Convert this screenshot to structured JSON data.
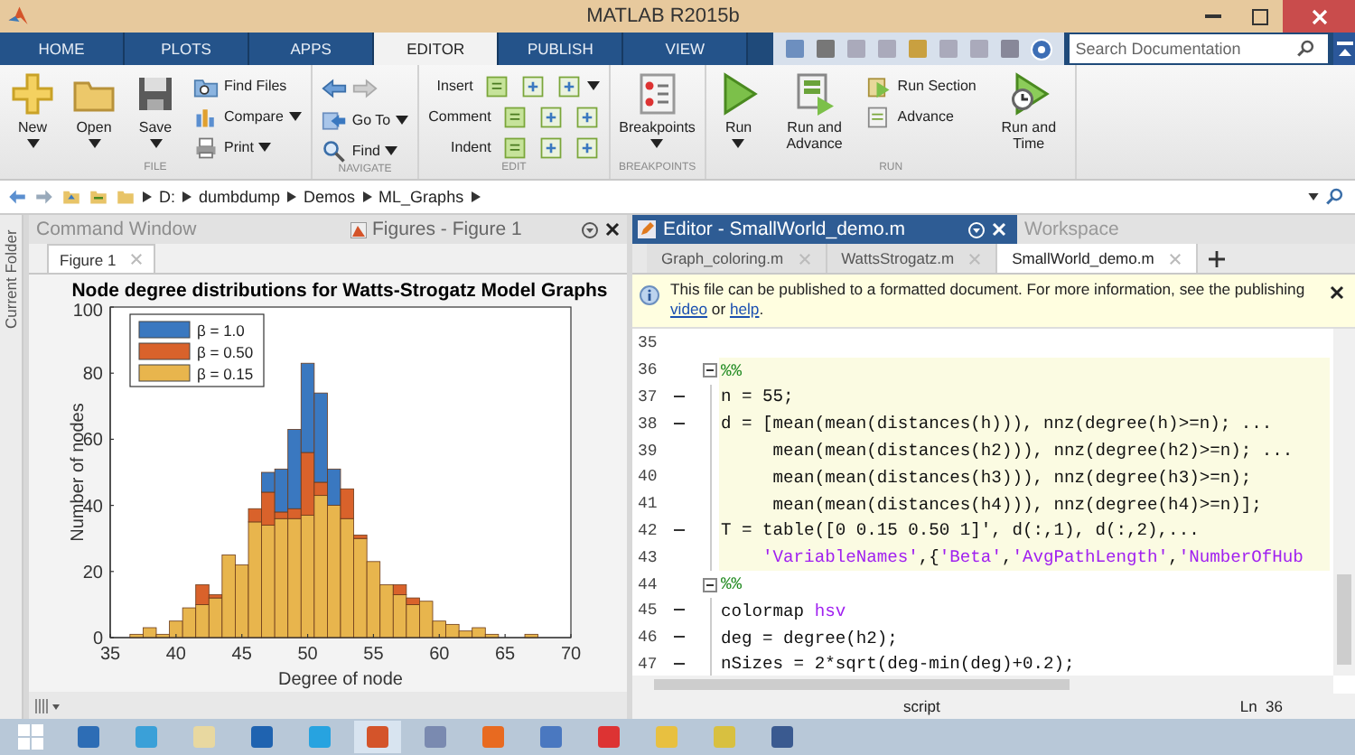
{
  "window": {
    "title": "MATLAB R2015b"
  },
  "ribbon_tabs": [
    {
      "label": "HOME",
      "selected": false
    },
    {
      "label": "PLOTS",
      "selected": false
    },
    {
      "label": "APPS",
      "selected": false
    },
    {
      "label": "EDITOR",
      "selected": true
    },
    {
      "label": "PUBLISH",
      "selected": false
    },
    {
      "label": "VIEW",
      "selected": false
    }
  ],
  "search": {
    "placeholder": "Search Documentation"
  },
  "ribbon_groups": [
    {
      "title": "FILE",
      "items": [
        {
          "kind": "large",
          "label": "New",
          "dropdown": true
        },
        {
          "kind": "large",
          "label": "Open",
          "dropdown": true
        },
        {
          "kind": "large",
          "label": "Save",
          "dropdown": true
        },
        {
          "kind": "small",
          "label": "Find Files",
          "dropdown": false
        },
        {
          "kind": "small",
          "label": "Compare",
          "dropdown": true
        },
        {
          "kind": "small",
          "label": "Print",
          "dropdown": true
        }
      ]
    },
    {
      "title": "NAVIGATE",
      "items": [
        {
          "kind": "small",
          "dropdown": false
        },
        {
          "kind": "small",
          "label": "Go To",
          "dropdown": true
        },
        {
          "kind": "small",
          "label": "Find",
          "dropdown": true
        }
      ]
    },
    {
      "title": "EDIT",
      "items": [
        {
          "kind": "small",
          "label": "Insert",
          "dropdown": true
        },
        {
          "kind": "small",
          "label": "Comment",
          "dropdown": false
        },
        {
          "kind": "small",
          "label": "Indent",
          "dropdown": false
        }
      ]
    },
    {
      "title": "BREAKPOINTS",
      "items": [
        {
          "kind": "large",
          "label": "Breakpoints",
          "dropdown": true
        }
      ]
    },
    {
      "title": "RUN",
      "items": [
        {
          "kind": "large",
          "label": "Run",
          "dropdown": true
        },
        {
          "kind": "large",
          "label": "Run and Advance",
          "dropdown": false
        },
        {
          "kind": "small",
          "label": "Run Section",
          "dropdown": false
        },
        {
          "kind": "small",
          "label": "Advance",
          "dropdown": false
        },
        {
          "kind": "large",
          "label": "Run and Time",
          "dropdown": false
        }
      ]
    }
  ],
  "path_bar": {
    "crumbs": [
      "D:",
      "dumbdump",
      "Demos",
      "ML_Graphs"
    ]
  },
  "side_strip": {
    "label": "Current Folder"
  },
  "left_panel": {
    "tabs": [
      {
        "label": "Command Window",
        "selected": false
      },
      {
        "label": "Figures - Figure 1",
        "selected": true
      }
    ],
    "figure_tab": "Figure 1",
    "chart_data": {
      "type": "bar",
      "title": "Node degree distributions for Watts-Strogatz Model Graphs",
      "xlabel": "Degree of node",
      "ylabel": "Number of nodes",
      "x": [
        37,
        38,
        39,
        40,
        41,
        42,
        43,
        44,
        45,
        46,
        47,
        48,
        49,
        50,
        51,
        52,
        53,
        54,
        55,
        56,
        57,
        58,
        59,
        60,
        61,
        62,
        63,
        64,
        67
      ],
      "series": [
        {
          "name": "β = 1.0",
          "color": "#3a78c0",
          "values": [
            0,
            0,
            0,
            0,
            0,
            0,
            0,
            0,
            0,
            0,
            6,
            13,
            24,
            27,
            27,
            11,
            0,
            0,
            0,
            0,
            0,
            0,
            0,
            0,
            0,
            0,
            0,
            0,
            0
          ]
        },
        {
          "name": "β = 0.50",
          "color": "#d9622b",
          "values": [
            0,
            0,
            0,
            0,
            0,
            6,
            1,
            0,
            0,
            4,
            10,
            2,
            3,
            19,
            4,
            0,
            9,
            1,
            0,
            0,
            3,
            2,
            0,
            0,
            0,
            0,
            0,
            0,
            0
          ]
        },
        {
          "name": "β = 0.15",
          "color": "#e8b54d",
          "values": [
            1,
            3,
            1,
            5,
            9,
            10,
            12,
            25,
            22,
            35,
            34,
            36,
            36,
            37,
            43,
            40,
            36,
            30,
            23,
            16,
            13,
            10,
            11,
            5,
            4,
            2,
            3,
            1,
            1
          ]
        }
      ],
      "xlim": [
        35,
        70
      ],
      "ylim": [
        0,
        100
      ],
      "xticks": [
        35,
        40,
        45,
        50,
        55,
        60,
        65,
        70
      ],
      "yticks": [
        0,
        20,
        40,
        60,
        80,
        100
      ],
      "stacked": true,
      "legend": true
    }
  },
  "editor": {
    "title": "Editor - SmallWorld_demo.m",
    "other_panel": "Workspace",
    "tabs": [
      {
        "label": "Graph_coloring.m",
        "selected": false
      },
      {
        "label": "WattsStrogatz.m",
        "selected": false
      },
      {
        "label": "SmallWorld_demo.m",
        "selected": true
      }
    ],
    "notice": [
      {
        "text": "This file can be published to a formatted document. For more information, see the publishing ",
        "link": false
      },
      {
        "text": "video",
        "link": true
      },
      {
        "text": " or ",
        "link": false
      },
      {
        "text": "help",
        "link": true
      },
      {
        "text": ".",
        "link": false
      }
    ],
    "lines": [
      {
        "number": "35",
        "executable": false,
        "fold": false,
        "in_cell": false
      },
      {
        "number": "36",
        "executable": false,
        "fold": true,
        "in_cell": true,
        "segments": [
          {
            "kind": "comment",
            "text": "%%"
          }
        ]
      },
      {
        "number": "37",
        "executable": true,
        "fold": false,
        "in_cell": true,
        "segments": [
          {
            "kind": "plain",
            "text": "n = 55;"
          }
        ]
      },
      {
        "number": "38",
        "executable": true,
        "fold": false,
        "in_cell": true,
        "segments": [
          {
            "kind": "plain",
            "text": "d = [mean(mean(distances(h))), nnz(degree(h)>=n); ..."
          }
        ]
      },
      {
        "number": "39",
        "executable": false,
        "fold": false,
        "in_cell": true,
        "segments": [
          {
            "kind": "plain",
            "text": "     mean(mean(distances(h2))), nnz(degree(h2)>=n); ..."
          }
        ]
      },
      {
        "number": "40",
        "executable": false,
        "fold": false,
        "in_cell": true,
        "segments": [
          {
            "kind": "plain",
            "text": "     mean(mean(distances(h3))), nnz(degree(h3)>=n);"
          }
        ]
      },
      {
        "number": "41",
        "executable": false,
        "fold": false,
        "in_cell": true,
        "segments": [
          {
            "kind": "plain",
            "text": "     mean(mean(distances(h4))), nnz(degree(h4)>=n)];"
          }
        ]
      },
      {
        "number": "42",
        "executable": true,
        "fold": false,
        "in_cell": true,
        "segments": [
          {
            "kind": "plain",
            "text": "T = table([0 0.15 0.50 1]', d(:,1), d(:,2),..."
          }
        ]
      },
      {
        "number": "43",
        "executable": false,
        "fold": false,
        "in_cell": true,
        "segments": [
          {
            "kind": "string",
            "text": "    'VariableNames'"
          },
          {
            "kind": "plain",
            "text": ",{"
          },
          {
            "kind": "string",
            "text": "'Beta'"
          },
          {
            "kind": "plain",
            "text": ","
          },
          {
            "kind": "string",
            "text": "'AvgPathLength'"
          },
          {
            "kind": "plain",
            "text": ","
          },
          {
            "kind": "string",
            "text": "'NumberOfHub"
          }
        ]
      },
      {
        "number": "44",
        "executable": false,
        "fold": true,
        "in_cell": false,
        "segments": [
          {
            "kind": "comment",
            "text": "%%"
          }
        ]
      },
      {
        "number": "45",
        "executable": true,
        "fold": false,
        "in_cell": false,
        "segments": [
          {
            "kind": "plain",
            "text": "colormap "
          },
          {
            "kind": "string",
            "text": "hsv"
          }
        ]
      },
      {
        "number": "46",
        "executable": true,
        "fold": false,
        "in_cell": false,
        "segments": [
          {
            "kind": "plain",
            "text": "deg = degree(h2);"
          }
        ]
      },
      {
        "number": "47",
        "executable": true,
        "fold": false,
        "in_cell": false,
        "segments": [
          {
            "kind": "plain",
            "text": "nSizes = 2*sqrt(deg-min(deg)+0.2);"
          }
        ]
      }
    ]
  },
  "status_bar": {
    "mode": "script",
    "position": "Ln  36"
  }
}
